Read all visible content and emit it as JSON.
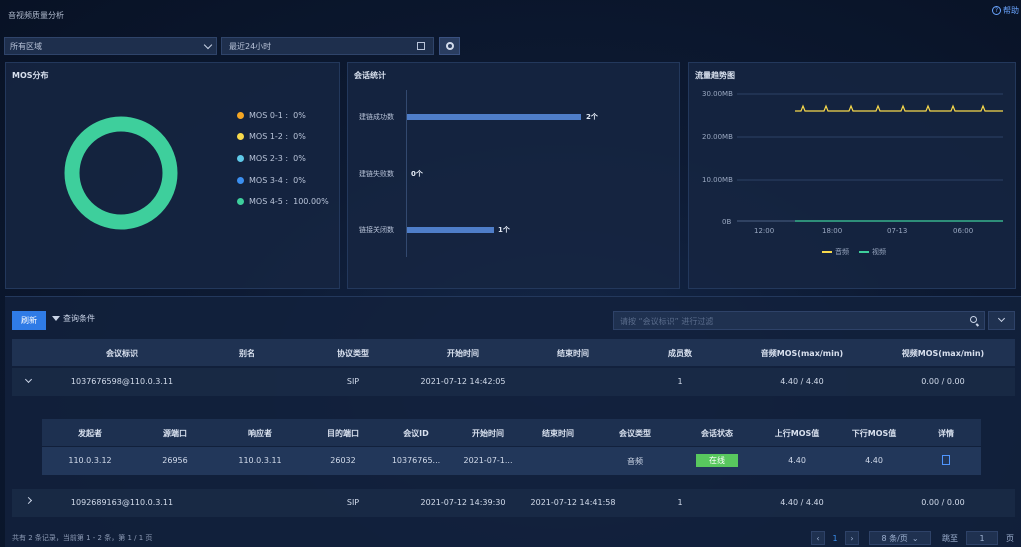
{
  "page": {
    "title": "音视频质量分析",
    "help": "帮助"
  },
  "filters": {
    "region": "所有区域",
    "time_range": "最近24小时"
  },
  "mos": {
    "title": "MOS分布",
    "legend": [
      {
        "label": "MOS 0-1 :",
        "value": "0%",
        "color": "#f5a623"
      },
      {
        "label": "MOS 1-2 :",
        "value": "0%",
        "color": "#f7d94c"
      },
      {
        "label": "MOS 2-3 :",
        "value": "0%",
        "color": "#5fc9e8"
      },
      {
        "label": "MOS 3-4 :",
        "value": "0%",
        "color": "#3b8ff0"
      },
      {
        "label": "MOS 4-5 :",
        "value": "100.00%",
        "color": "#3ecf9c"
      }
    ]
  },
  "session": {
    "title": "会话统计",
    "bars": [
      {
        "label": "建链成功数",
        "value": 2,
        "display": "2个"
      },
      {
        "label": "建链失败数",
        "value": 0,
        "display": "0个"
      },
      {
        "label": "链接关闭数",
        "value": 1,
        "display": "1个"
      }
    ]
  },
  "traffic": {
    "title": "流量趋势图",
    "y_ticks": [
      "30.00MB",
      "20.00MB",
      "10.00MB",
      "0B"
    ],
    "x_ticks": [
      "12:00",
      "18:00",
      "07-13",
      "06:00"
    ],
    "legend": [
      {
        "name": "音频",
        "color": "#f7d94c"
      },
      {
        "name": "视频",
        "color": "#3ecf9c"
      }
    ]
  },
  "toolbar": {
    "refresh": "刷新",
    "filter": "查询条件",
    "search_placeholder": "请按 “会议标识” 进行过滤"
  },
  "table": {
    "headers": [
      "会议标识",
      "别名",
      "协议类型",
      "开始时间",
      "结束时间",
      "成员数",
      "音频MOS(max/min)",
      "视频MOS(max/min)"
    ],
    "rows": [
      {
        "id": "1037676598@110.0.3.11",
        "alias": "",
        "protocol": "SIP",
        "start": "2021-07-12 14:42:05",
        "end": "",
        "members": "1",
        "audio_mos": "4.40 / 4.40",
        "video_mos": "0.00 / 0.00",
        "expanded": true
      },
      {
        "id": "1092689163@110.0.3.11",
        "alias": "",
        "protocol": "SIP",
        "start": "2021-07-12 14:39:30",
        "end": "2021-07-12 14:41:58",
        "members": "1",
        "audio_mos": "4.40 / 4.40",
        "video_mos": "0.00 / 0.00",
        "expanded": false
      }
    ]
  },
  "subtable": {
    "headers": [
      "发起者",
      "源端口",
      "响应者",
      "目的端口",
      "会议ID",
      "开始时间",
      "结束时间",
      "会议类型",
      "会话状态",
      "上行MOS值",
      "下行MOS值",
      "详情"
    ],
    "row": {
      "caller": "110.0.3.12",
      "src_port": "26956",
      "callee": "110.0.3.11",
      "dst_port": "26032",
      "conf_id": "10376765...",
      "start": "2021-07-1...",
      "end": "",
      "type": "音频",
      "status": "在线",
      "up_mos": "4.40",
      "down_mos": "4.40"
    }
  },
  "footer": {
    "summary": "共有 2 条记录，当前第 1 - 2 条，第 1 / 1 页",
    "current_page": "1",
    "page_size": "8 条/页",
    "goto_label": "跳至",
    "goto_value": "1",
    "page_unit": "页"
  }
}
